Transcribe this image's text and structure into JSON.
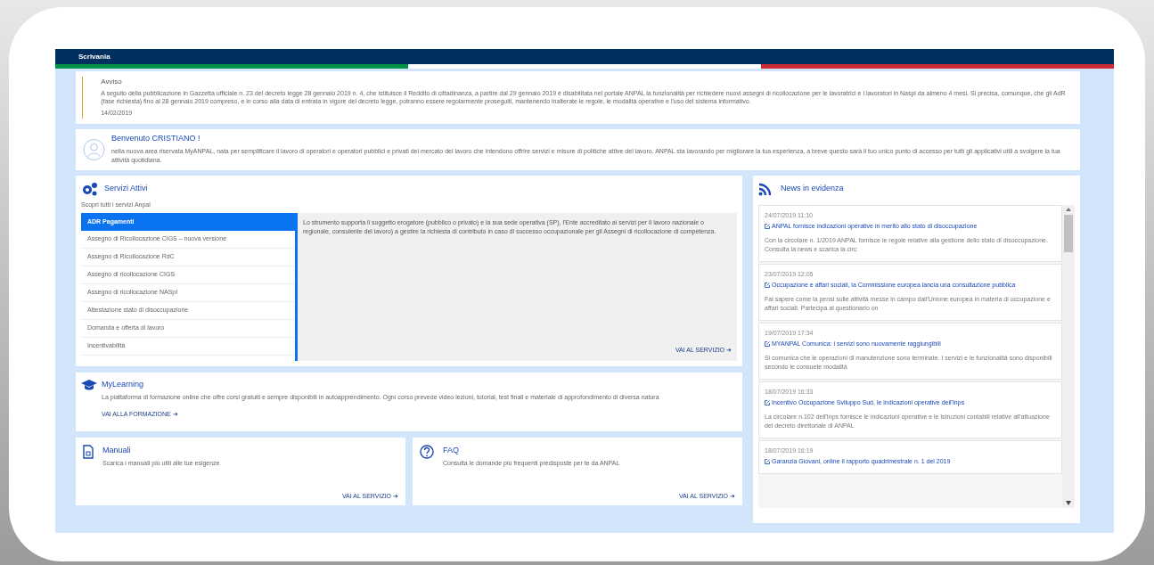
{
  "header": {
    "title": "Scrivania"
  },
  "notice": {
    "title": "Avviso",
    "text": "A seguito della pubblicazione in Gazzetta ufficiale n. 23 del decreto legge 28 gennaio 2019 n. 4, che istituisce il Reddito di cittadinanza, a partire dal 29 gennaio 2019 è disabilitata nel portale ANPAL la funzionalità per richiedere nuovi assegni di ricollocazione per le lavoratrici e i lavoratori in Naspi da almeno 4 mesi. Si precisa, comunque, che gli AdR (fase richiesta) fino al 28 gennaio 2019 compreso, e in corso alla data di entrata in vigore del decreto legge, potranno essere regolarmente proseguiti, mantenendo inalterate le regole, le modalità operative e l'uso del sistema informativo.",
    "date": "14/02/2019"
  },
  "welcome": {
    "title": "Benvenuto CRISTIANO !",
    "text": "nella nuova area riservata MyANPAL, nata per semplificare il lavoro di operatori e operatori pubblici e privati del mercato del lavoro che intendono offrire servizi e misure di politiche attive del lavoro. ANPAL sta lavorando per migliorare la tua esperienza, a breve questo sarà il tuo unico punto di accesso per tutti gli applicativi utili a svolgere la tua attività quotidiana."
  },
  "services": {
    "title": "Servizi Attivi",
    "subtitle": "Scopri tutti i servizi Anpal",
    "items": [
      {
        "label": "ADR Pagamenti",
        "selected": true
      },
      {
        "label": "Assegno di Ricollocazione CIGS – nuova versione",
        "selected": false
      },
      {
        "label": "Assegno di Ricollocazione RdC",
        "selected": false
      },
      {
        "label": "Assegno di ricollocazione CIGS",
        "selected": false
      },
      {
        "label": "Assegno di ricollocazione NASpI",
        "selected": false
      },
      {
        "label": "Attestazione stato di disoccupazione",
        "selected": false
      },
      {
        "label": "Domanda e offerta di lavoro",
        "selected": false
      },
      {
        "label": "Incentivabilità",
        "selected": false
      }
    ],
    "description": "Lo strumento supporta il soggetto erogatore (pubblico o privato) e la sua sede operativa (SP), l'Ente accreditato ai servizi per il lavoro nazionale o regionale, consulente del lavoro) a gestire la richiesta di contributo in caso di successo occupazionale per gli Assegni di ricollocazione di competenza.",
    "link": "VAI AL SERVIZIO ➜"
  },
  "learning": {
    "title": "MyLearning",
    "text": "La piattaforma di formazione online che offre corsi gratuiti e sempre disponibili in autoapprendimento. Ogni corso prevede video lezioni, tutorial, test finali e materiale di approfondimento di diversa natura",
    "link": "VAI ALLA FORMAZIONE ➜"
  },
  "cards": [
    {
      "kind": "manual",
      "title": "Manuali",
      "text": "Scarica i manuali più utili alle tue esigenze",
      "link": "VAI AL SERVIZIO ➜"
    },
    {
      "kind": "faq",
      "title": "FAQ",
      "text": "Consulta le domande più frequenti predisposte per te da ANPAL",
      "link": "VAI AL SERVIZIO ➜"
    }
  ],
  "news": {
    "title": "News in evidenza",
    "items": [
      {
        "date": "24/07/2019 11:10",
        "title": "ANPAL fornisce indicazioni operative in merito allo stato di disoccupazione",
        "summary": "Con la circolare n. 1/2019 ANPAL fornisce le regole relative alla gestione dello stato di disoccupazione. Consulta la news e scarica la circ"
      },
      {
        "date": "23/07/2019 12:05",
        "title": "Occupazione e affari sociali, la Commissione europea lancia una consultazione pubblica",
        "summary": "Fai sapere come la pensi sulle attività messe in campo dall'Unione europea in materia di occupazione e affari sociali. Partecipa al questionario on"
      },
      {
        "date": "19/07/2019 17:34",
        "title": "MYANPAL Comunica: i servizi sono nuovamente raggiungibili",
        "summary": "Si comunica che le operazioni di manutenzione sono terminate. I servizi e le funzionalità sono disponibili secondo le consuete modalità"
      },
      {
        "date": "18/07/2019 16:33",
        "title": "Incentivo Occupazione Sviluppo Sud, le indicazioni operative dell'Inps",
        "summary": "La circolare n.102 dell'Inps fornisce le indicazioni operative e le istruzioni contabili relative all'attuazione del decreto direttoriale di ANPAL"
      },
      {
        "date": "18/07/2019 16:19",
        "title": "Garanzia Giovani, online il rapporto quadrimestrale n. 1 del 2019"
      }
    ]
  }
}
